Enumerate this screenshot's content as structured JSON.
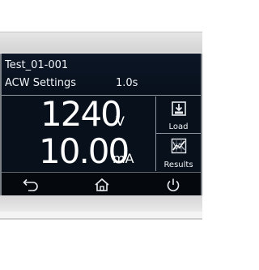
{
  "header": {
    "test_name": "Test_01-001",
    "settings_label": "ACW Settings",
    "ramp_time": "1.0s"
  },
  "readings": {
    "voltage": {
      "value": "1240",
      "unit": "V"
    },
    "current": {
      "value": "10.00",
      "unit": "mA"
    }
  },
  "side_buttons": {
    "load": {
      "label": "Load",
      "icon": "load-icon"
    },
    "results": {
      "label": "Results",
      "icon": "results-icon"
    }
  },
  "nav": {
    "back_icon": "back-icon",
    "home_icon": "home-icon",
    "power_icon": "power-icon"
  },
  "colors": {
    "screen_bg": "#0a0f18",
    "text": "#f2f4f7",
    "divider": "#8d95a2"
  }
}
